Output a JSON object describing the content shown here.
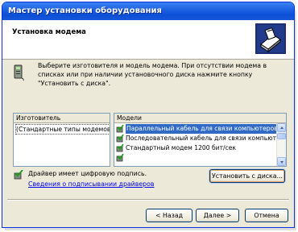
{
  "window": {
    "title": "Мастер установки оборудования"
  },
  "header": {
    "title": "Установка модема"
  },
  "description": "Выберите изготовителя и модель модема. При отсутствии модема в списках или при наличии установочного диска нажмите кнопку \"Установить с диска\".",
  "manufacturers": {
    "header": "Изготовитель",
    "items": [
      "(Стандартные типы модемов)"
    ]
  },
  "models": {
    "header": "Модели",
    "items": [
      "Параллельный кабель для связи компьютеров",
      "Последовательный кабель для связи компьютерс",
      "Стандартный модем 1200 бит/сек"
    ]
  },
  "signature": {
    "text": "Драйвер имеет цифровую подпись.",
    "link": "Сведения о подписывании драйверов"
  },
  "buttons": {
    "have_disk": "Установить с диска...",
    "back": "< Назад",
    "next": "Далее >",
    "cancel": "Отмена"
  },
  "colors": {
    "titlebar": "#0a4fd6",
    "selection": "#316ac5",
    "face": "#ece9d8"
  }
}
